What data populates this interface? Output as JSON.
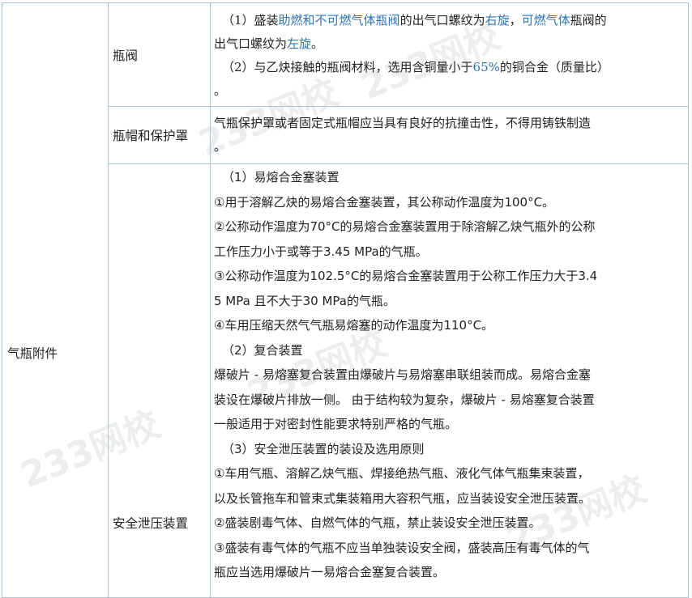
{
  "category": "气瓶附件",
  "rows": [
    {
      "name": "瓶阀",
      "lines": [
        [
          {
            "t": "（1）盛装"
          },
          {
            "t": "助燃和不可燃气体瓶阀",
            "hl": true
          },
          {
            "t": "的出气口螺纹为"
          },
          {
            "t": "右旋",
            "hl": true
          },
          {
            "t": "，"
          },
          {
            "t": "可燃气体",
            "hl": true
          },
          {
            "t": "瓶阀的"
          }
        ],
        [
          {
            "t": "出气口螺纹为"
          },
          {
            "t": "左旋",
            "hl": true
          },
          {
            "t": "。"
          }
        ],
        [
          {
            "t": "（2）与乙炔接触的瓶阀材料，选用含铜量小于"
          },
          {
            "t": "65%",
            "hl": true
          },
          {
            "t": "的铜合金（质量比）"
          }
        ],
        [
          {
            "t": "。"
          }
        ]
      ]
    },
    {
      "name": "瓶帽和保护罩",
      "lines": [
        [
          {
            "t": "气瓶保护罩或者固定式瓶帽应当具有良好的抗撞击性，不得用铸铁制造"
          }
        ],
        [
          {
            "t": "。"
          }
        ]
      ]
    },
    {
      "name": "安全泄压装置",
      "lines": [
        "（1）易熔合金塞装置",
        "①用于溶解乙炔的易熔合金塞装置，其公称动作温度为100°C。",
        "②公称动作温度为70°C的易熔合金塞装置用于除溶解乙炔气瓶外的公称",
        "工作压力小于或等于3.45 MPa的气瓶。",
        "③公称动作温度为102.5°C的易熔合金塞装置用于公称工作压力大于3.4",
        "5 MPa 且不大于30 MPa的气瓶。",
        "④车用压缩天然气气瓶易熔塞的动作温度为110°C。",
        "（2）复合装置",
        "爆破片 - 易熔塞复合装置由爆破片与易熔塞串联组装而成。易熔合金塞",
        "装设在爆破片排放一侧。 由于结构较为复杂，爆破片 - 易熔塞复合装置",
        "一般适用于对密封性能要求特别严格的气瓶。",
        "（3）安全泄压装置的装设及选用原则",
        "①车用气瓶、溶解乙炔气瓶、焊接绝热气瓶、液化气体气瓶集束装置，",
        "以及长管拖车和管束式集装箱用大容积气瓶，应当装设安全泄压装置。",
        "②盛装剧毒气体、自燃气体的气瓶，禁止装设安全泄压装置。",
        "③盛装有毒气体的气瓶不应当单独装设安全阀，盛装高压有毒气体的气",
        "瓶应当选用爆破片一易熔合金塞复合装置。"
      ]
    }
  ],
  "watermark": "233网校",
  "colors": {
    "highlight": "#2e74b5",
    "border": "#a9c4d6"
  }
}
